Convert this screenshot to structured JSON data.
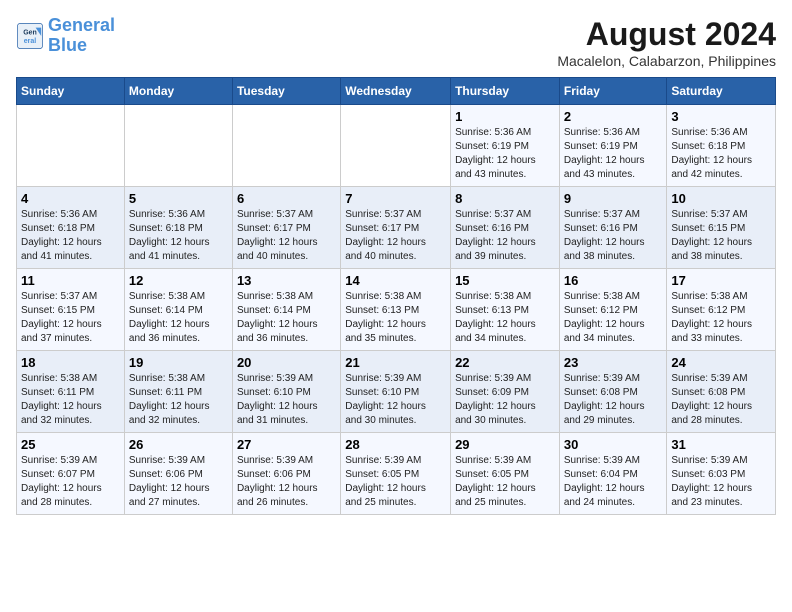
{
  "logo": {
    "line1": "General",
    "line2": "Blue"
  },
  "title": "August 2024",
  "subtitle": "Macalelon, Calabarzon, Philippines",
  "days_of_week": [
    "Sunday",
    "Monday",
    "Tuesday",
    "Wednesday",
    "Thursday",
    "Friday",
    "Saturday"
  ],
  "weeks": [
    [
      {
        "day": "",
        "info": ""
      },
      {
        "day": "",
        "info": ""
      },
      {
        "day": "",
        "info": ""
      },
      {
        "day": "",
        "info": ""
      },
      {
        "day": "1",
        "info": "Sunrise: 5:36 AM\nSunset: 6:19 PM\nDaylight: 12 hours\nand 43 minutes."
      },
      {
        "day": "2",
        "info": "Sunrise: 5:36 AM\nSunset: 6:19 PM\nDaylight: 12 hours\nand 43 minutes."
      },
      {
        "day": "3",
        "info": "Sunrise: 5:36 AM\nSunset: 6:18 PM\nDaylight: 12 hours\nand 42 minutes."
      }
    ],
    [
      {
        "day": "4",
        "info": "Sunrise: 5:36 AM\nSunset: 6:18 PM\nDaylight: 12 hours\nand 41 minutes."
      },
      {
        "day": "5",
        "info": "Sunrise: 5:36 AM\nSunset: 6:18 PM\nDaylight: 12 hours\nand 41 minutes."
      },
      {
        "day": "6",
        "info": "Sunrise: 5:37 AM\nSunset: 6:17 PM\nDaylight: 12 hours\nand 40 minutes."
      },
      {
        "day": "7",
        "info": "Sunrise: 5:37 AM\nSunset: 6:17 PM\nDaylight: 12 hours\nand 40 minutes."
      },
      {
        "day": "8",
        "info": "Sunrise: 5:37 AM\nSunset: 6:16 PM\nDaylight: 12 hours\nand 39 minutes."
      },
      {
        "day": "9",
        "info": "Sunrise: 5:37 AM\nSunset: 6:16 PM\nDaylight: 12 hours\nand 38 minutes."
      },
      {
        "day": "10",
        "info": "Sunrise: 5:37 AM\nSunset: 6:15 PM\nDaylight: 12 hours\nand 38 minutes."
      }
    ],
    [
      {
        "day": "11",
        "info": "Sunrise: 5:37 AM\nSunset: 6:15 PM\nDaylight: 12 hours\nand 37 minutes."
      },
      {
        "day": "12",
        "info": "Sunrise: 5:38 AM\nSunset: 6:14 PM\nDaylight: 12 hours\nand 36 minutes."
      },
      {
        "day": "13",
        "info": "Sunrise: 5:38 AM\nSunset: 6:14 PM\nDaylight: 12 hours\nand 36 minutes."
      },
      {
        "day": "14",
        "info": "Sunrise: 5:38 AM\nSunset: 6:13 PM\nDaylight: 12 hours\nand 35 minutes."
      },
      {
        "day": "15",
        "info": "Sunrise: 5:38 AM\nSunset: 6:13 PM\nDaylight: 12 hours\nand 34 minutes."
      },
      {
        "day": "16",
        "info": "Sunrise: 5:38 AM\nSunset: 6:12 PM\nDaylight: 12 hours\nand 34 minutes."
      },
      {
        "day": "17",
        "info": "Sunrise: 5:38 AM\nSunset: 6:12 PM\nDaylight: 12 hours\nand 33 minutes."
      }
    ],
    [
      {
        "day": "18",
        "info": "Sunrise: 5:38 AM\nSunset: 6:11 PM\nDaylight: 12 hours\nand 32 minutes."
      },
      {
        "day": "19",
        "info": "Sunrise: 5:38 AM\nSunset: 6:11 PM\nDaylight: 12 hours\nand 32 minutes."
      },
      {
        "day": "20",
        "info": "Sunrise: 5:39 AM\nSunset: 6:10 PM\nDaylight: 12 hours\nand 31 minutes."
      },
      {
        "day": "21",
        "info": "Sunrise: 5:39 AM\nSunset: 6:10 PM\nDaylight: 12 hours\nand 30 minutes."
      },
      {
        "day": "22",
        "info": "Sunrise: 5:39 AM\nSunset: 6:09 PM\nDaylight: 12 hours\nand 30 minutes."
      },
      {
        "day": "23",
        "info": "Sunrise: 5:39 AM\nSunset: 6:08 PM\nDaylight: 12 hours\nand 29 minutes."
      },
      {
        "day": "24",
        "info": "Sunrise: 5:39 AM\nSunset: 6:08 PM\nDaylight: 12 hours\nand 28 minutes."
      }
    ],
    [
      {
        "day": "25",
        "info": "Sunrise: 5:39 AM\nSunset: 6:07 PM\nDaylight: 12 hours\nand 28 minutes."
      },
      {
        "day": "26",
        "info": "Sunrise: 5:39 AM\nSunset: 6:06 PM\nDaylight: 12 hours\nand 27 minutes."
      },
      {
        "day": "27",
        "info": "Sunrise: 5:39 AM\nSunset: 6:06 PM\nDaylight: 12 hours\nand 26 minutes."
      },
      {
        "day": "28",
        "info": "Sunrise: 5:39 AM\nSunset: 6:05 PM\nDaylight: 12 hours\nand 25 minutes."
      },
      {
        "day": "29",
        "info": "Sunrise: 5:39 AM\nSunset: 6:05 PM\nDaylight: 12 hours\nand 25 minutes."
      },
      {
        "day": "30",
        "info": "Sunrise: 5:39 AM\nSunset: 6:04 PM\nDaylight: 12 hours\nand 24 minutes."
      },
      {
        "day": "31",
        "info": "Sunrise: 5:39 AM\nSunset: 6:03 PM\nDaylight: 12 hours\nand 23 minutes."
      }
    ]
  ]
}
